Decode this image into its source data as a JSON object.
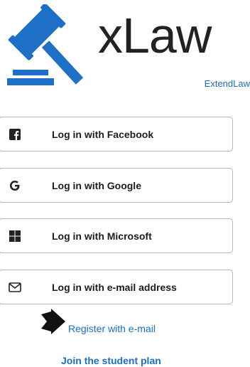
{
  "header": {
    "brand": "xLaw",
    "subtitle_link": "ExtendLaw",
    "logo_color": "#1e6fc6"
  },
  "login_options": [
    {
      "label": "Log in with Facebook",
      "icon": "facebook-icon"
    },
    {
      "label": "Log in with Google",
      "icon": "google-icon"
    },
    {
      "label": "Log in with Microsoft",
      "icon": "microsoft-icon"
    },
    {
      "label": "Log in with e-mail address",
      "icon": "envelope-icon"
    }
  ],
  "links": {
    "register": "Register with e-mail",
    "student_plan": "Join the student plan"
  },
  "colors": {
    "link": "#1a6fc4",
    "button_border": "#b5b5b5",
    "text": "#1c1c1c"
  }
}
